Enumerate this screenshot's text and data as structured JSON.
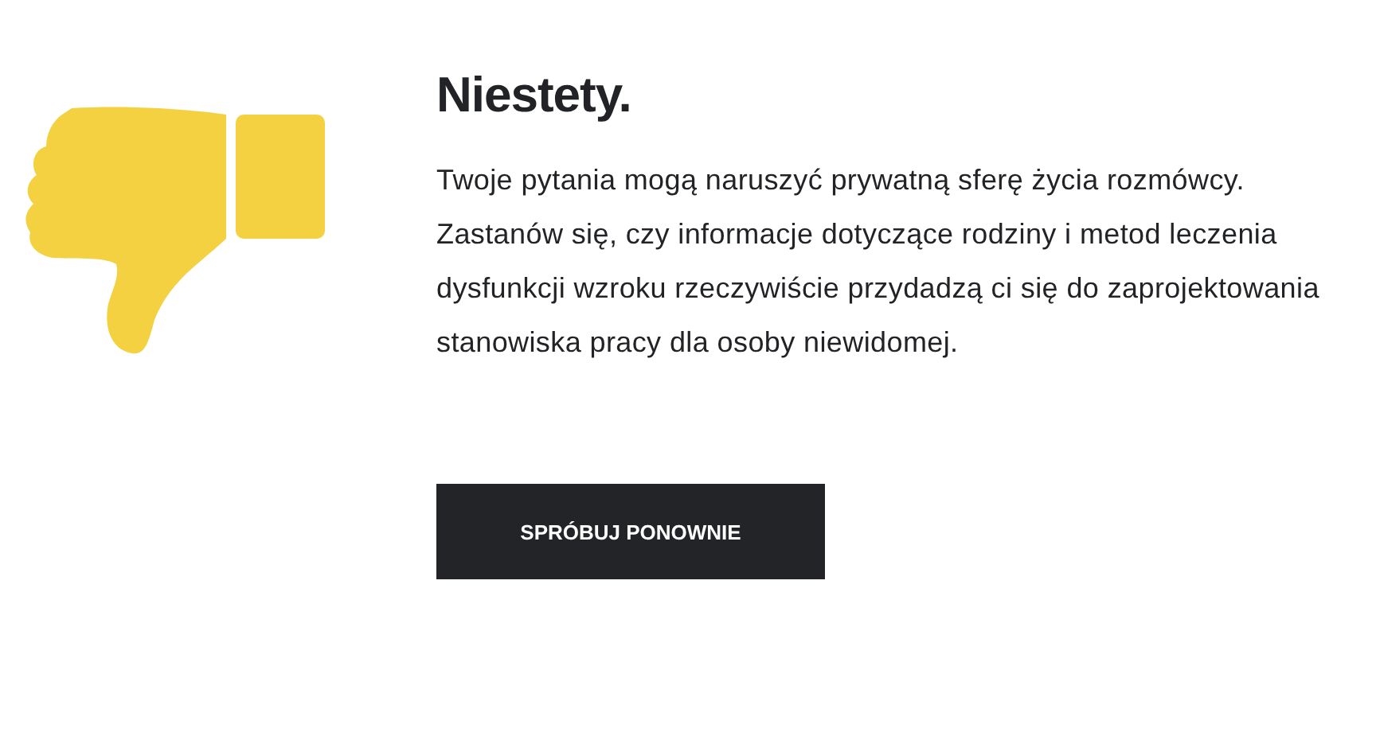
{
  "title": "Niestety.",
  "message": "Twoje pytania mogą naruszyć prywatną sferę życia rozmówcy. Zastanów się, czy informacje dotyczące rodziny i metod leczenia dysfunkcji wzroku rzeczywiście przydadzą ci się do zaprojektowania stanowiska pracy dla osoby niewidomej.",
  "button": "SPRÓBUJ PONOWNIE"
}
